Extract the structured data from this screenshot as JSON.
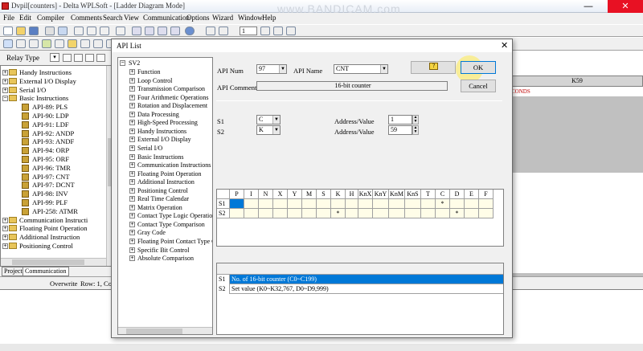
{
  "window": {
    "title": "Dvpil[counters] - Delta WPLSoft - [Ladder Diagram Mode]",
    "watermark": "www.BANDICAM.com",
    "minimize": "—",
    "close": "✕"
  },
  "menu": [
    "File",
    "Edit",
    "Compiler",
    "Comments",
    "Search",
    "View",
    "Communication",
    "Options",
    "Wizard",
    "Window",
    "Help"
  ],
  "toolbar": {
    "step_value": "1"
  },
  "relay": {
    "label": "Relay Type",
    "dropdown_arrow": "▾"
  },
  "left_tree": [
    {
      "label": "Handy Instructions",
      "type": "folder"
    },
    {
      "label": "External I/O Display",
      "type": "folder"
    },
    {
      "label": "Serial I/O",
      "type": "folder"
    },
    {
      "label": "Basic Instructions",
      "type": "folder-open"
    },
    {
      "label": "API-89: PLS",
      "type": "item"
    },
    {
      "label": "API-90: LDP",
      "type": "item"
    },
    {
      "label": "API-91: LDF",
      "type": "item"
    },
    {
      "label": "API-92: ANDP",
      "type": "item"
    },
    {
      "label": "API-93: ANDF",
      "type": "item"
    },
    {
      "label": "API-94: ORP",
      "type": "item"
    },
    {
      "label": "API-95: ORF",
      "type": "item"
    },
    {
      "label": "API-96: TMR",
      "type": "item"
    },
    {
      "label": "API-97: CNT",
      "type": "item"
    },
    {
      "label": "API-97: DCNT",
      "type": "item"
    },
    {
      "label": "API-98: INV",
      "type": "item"
    },
    {
      "label": "API-99: PLF",
      "type": "item"
    },
    {
      "label": "API-258: ATMR",
      "type": "item"
    },
    {
      "label": "Communication Instructi",
      "type": "folder"
    },
    {
      "label": "Floating Point Operation",
      "type": "folder"
    },
    {
      "label": "Additional Instruction",
      "type": "folder"
    },
    {
      "label": "Positioning Control",
      "type": "folder"
    }
  ],
  "left_tabs": [
    "Project",
    "Communication"
  ],
  "editor": {
    "k_label": "K59",
    "conds": "CONDS"
  },
  "status": {
    "mode": "Overwrite",
    "row": "Row: 1, Col:"
  },
  "dialog": {
    "title": "API List",
    "close": "✕",
    "tree_root": "SV2",
    "tree_items": [
      "Function",
      "Loop Control",
      "Transmission Comparison",
      "Four Arithmetic Operations",
      "Rotation and Displacement",
      "Data Processing",
      "High-Speed Processing",
      "Handy Instructions",
      "External I/O Display",
      "Serial I/O",
      "Basic Instructions",
      "Communication Instructions",
      "Floating Point Operation",
      "Additional Instruction",
      "Positioning Control",
      "Real Time Calendar",
      "Matrix Operation",
      "Contact Type Logic Operation",
      "Contact Type Comparison",
      "Gray Code",
      "Floating Point Contact Type C",
      "Specific Bit Control",
      "Absolute Comparison"
    ],
    "api_num_label": "API Num",
    "api_num_value": "97",
    "api_name_label": "API Name",
    "api_name_value": "CNT",
    "api_comment_label": "API Comment",
    "api_comment_value": "16-bit counter",
    "help_glyph": "?",
    "ok_label": "OK",
    "cancel_label": "Cancel",
    "s1_label": "S1",
    "s1_value": "C",
    "s1_addr_label": "Address/Value",
    "s1_addr_value": "1",
    "s2_label": "S2",
    "s2_value": "K",
    "s2_addr_label": "Address/Value",
    "s2_addr_value": "59",
    "grid_headers": [
      "",
      "P",
      "I",
      "N",
      "X",
      "Y",
      "M",
      "S",
      "K",
      "H",
      "KnX",
      "KnY",
      "KnM",
      "KnS",
      "T",
      "C",
      "D",
      "E",
      "F"
    ],
    "grid_rows": [
      {
        "label": "S1",
        "cells": [
          "",
          "",
          "",
          "",
          "",
          "",
          "",
          "",
          "",
          "",
          "",
          "",
          "",
          "",
          "*",
          "",
          "",
          ""
        ]
      },
      {
        "label": "S2",
        "cells": [
          "",
          "",
          "",
          "",
          "",
          "",
          "",
          "*",
          "",
          "",
          "",
          "",
          "",
          "",
          "",
          "*",
          "",
          ""
        ]
      }
    ],
    "desc_rows": [
      {
        "label": "S1",
        "text": "No. of 16-bit counter (C0~C199)"
      },
      {
        "label": "S2",
        "text": "Set value (K0~K32,767, D0~D9,999)"
      }
    ]
  }
}
